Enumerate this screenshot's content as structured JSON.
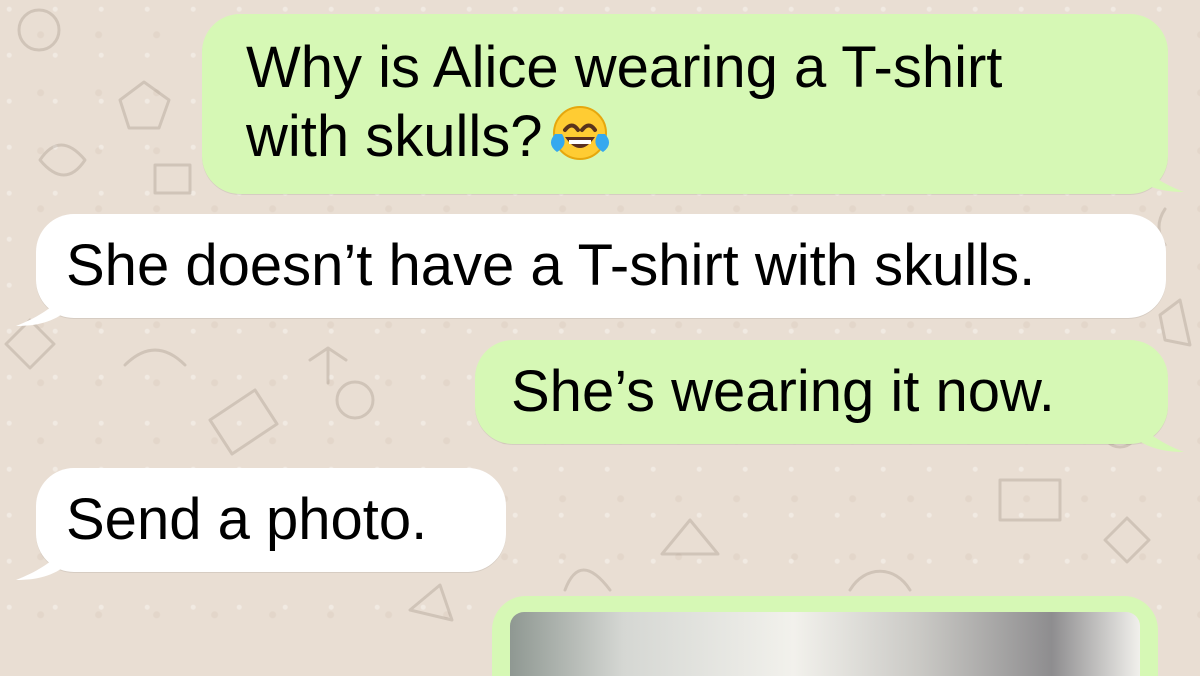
{
  "messages": [
    {
      "direction": "outgoing",
      "text": "Why is Alice wearing a T-shirt\nwith skulls?",
      "emoji": "face-with-tears-of-joy"
    },
    {
      "direction": "incoming",
      "text": "She doesn’t have a T-shirt with skulls."
    },
    {
      "direction": "outgoing",
      "text": "She’s wearing it now."
    },
    {
      "direction": "incoming",
      "text": "Send a photo."
    },
    {
      "direction": "outgoing",
      "type": "photo",
      "description": ""
    }
  ],
  "colors": {
    "background": "#e9ded3",
    "outgoing_bubble": "#d6f8b5",
    "incoming_bubble": "#ffffff",
    "text": "#000000"
  }
}
